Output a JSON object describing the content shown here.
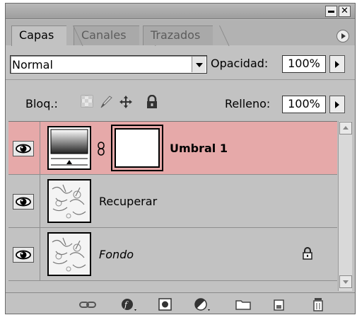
{
  "tabs": [
    {
      "label": "Capas",
      "active": true
    },
    {
      "label": "Canales",
      "active": false
    },
    {
      "label": "Trazados",
      "active": false
    }
  ],
  "blend": {
    "mode": "Normal",
    "opacity_label": "Opacidad:",
    "opacity_value": "100%"
  },
  "lock": {
    "label": "Bloq.:",
    "fill_label": "Relleno:",
    "fill_value": "100%"
  },
  "layers": [
    {
      "name": "Umbral 1",
      "selected": true,
      "bold": true,
      "type": "adjustment"
    },
    {
      "name": "Recuperar",
      "selected": false,
      "bold": false,
      "type": "image"
    },
    {
      "name": "Fondo",
      "selected": false,
      "bold": false,
      "italic": true,
      "locked": true,
      "type": "image"
    }
  ],
  "icons": {
    "window": [
      "minimize-icon",
      "close-icon"
    ],
    "lock": [
      "lock-transparency-icon",
      "lock-pixels-icon",
      "lock-position-icon",
      "lock-all-icon"
    ],
    "toolbar": [
      "link-layers-icon",
      "layer-style-icon",
      "layer-mask-icon",
      "adjustment-layer-icon",
      "new-group-icon",
      "new-layer-icon",
      "trash-icon"
    ]
  },
  "colors": {
    "selected_row": "#e6a9a9",
    "panel": "#c2c2c2"
  }
}
